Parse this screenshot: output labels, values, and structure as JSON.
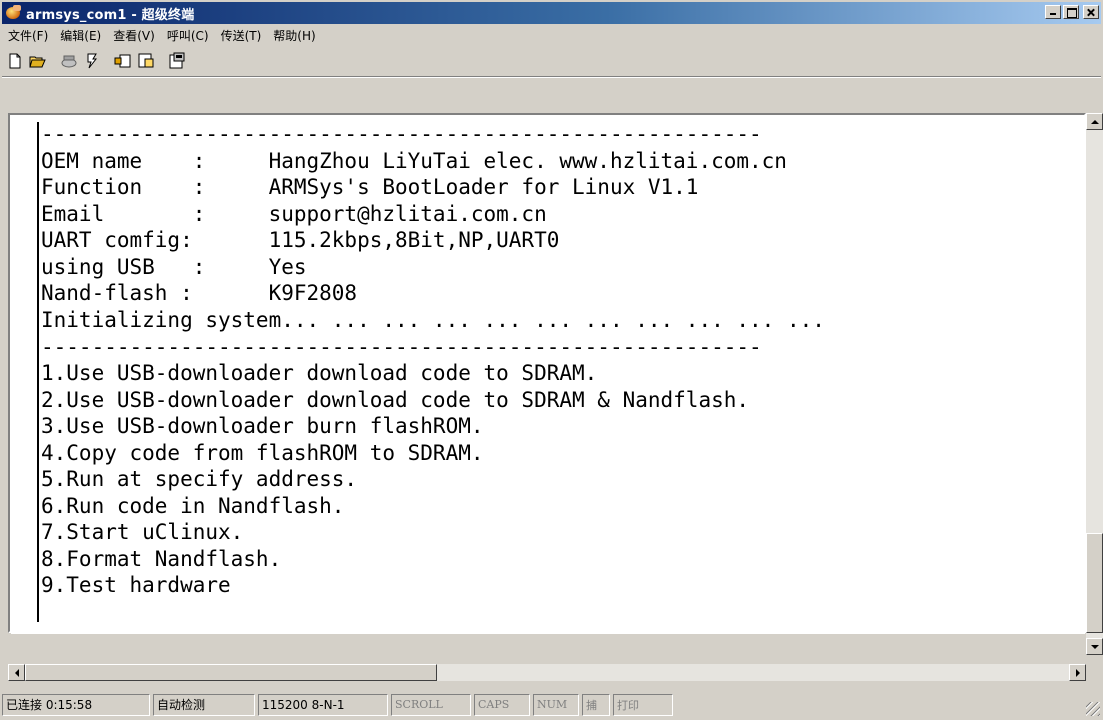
{
  "window": {
    "title": "armsys_com1 - 超级终端"
  },
  "menu": [
    "文件(F)",
    "编辑(E)",
    "查看(V)",
    "呼叫(C)",
    "传送(T)",
    "帮助(H)"
  ],
  "toolbar": [
    {
      "name": "new-icon",
      "label": "新建"
    },
    {
      "name": "open-icon",
      "label": "打开"
    },
    {
      "name": "call-icon",
      "label": "呼叫"
    },
    {
      "name": "disconnect-icon",
      "label": "断开"
    },
    {
      "name": "send-icon",
      "label": "发送"
    },
    {
      "name": "receive-icon",
      "label": "接收"
    },
    {
      "name": "properties-icon",
      "label": "属性"
    }
  ],
  "terminal": {
    "lines": [
      "---------------------------------------------------------",
      "OEM name    :     HangZhou LiYuTai elec. www.hzlitai.com.cn",
      "Function    :     ARMSys's BootLoader for Linux V1.1",
      "Email       :     support@hzlitai.com.cn",
      "UART comfig:      115.2kbps,8Bit,NP,UART0",
      "using USB   :     Yes",
      "Nand-flash :      K9F2808",
      "Initializing system... ... ... ... ... ... ... ... ... ... ...",
      "---------------------------------------------------------",
      "1.Use USB-downloader download code to SDRAM.",
      "2.Use USB-downloader download code to SDRAM & Nandflash.",
      "3.Use USB-downloader burn flashROM.",
      "4.Copy code from flashROM to SDRAM.",
      "5.Run at specify address.",
      "6.Run code in Nandflash.",
      "7.Start uClinux.",
      "8.Format Nandflash.",
      "9.Test hardware"
    ]
  },
  "status": {
    "connected": "已连接 0:15:58",
    "detect": "自动检测",
    "baud": "115200 8-N-1",
    "scroll": "SCROLL",
    "caps": "CAPS",
    "num": "NUM",
    "capture": "捕",
    "print": "打印"
  }
}
